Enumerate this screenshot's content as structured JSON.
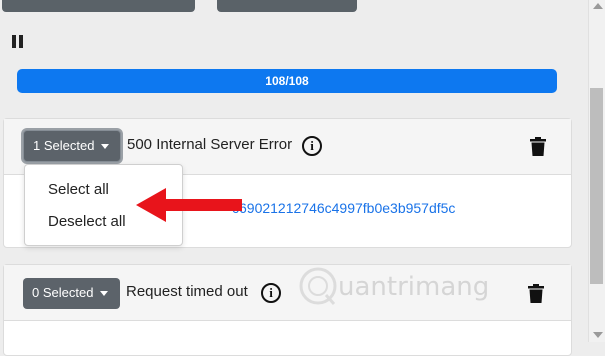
{
  "progress": {
    "text": "108/108",
    "value": 1.0
  },
  "groups": [
    {
      "select_label": "1 Selected",
      "error_text": "500 Internal Server Error",
      "link_text": "c69021212746c4997fb0e3b957df5c"
    },
    {
      "select_label": "0 Selected",
      "error_text": "Request timed out"
    }
  ],
  "dropdown_menu": {
    "items": [
      "Select all",
      "Deselect all"
    ]
  },
  "watermark": {
    "text": "Quantrimang"
  },
  "colors": {
    "progress": "#0d78f0",
    "button": "#5c636a",
    "link": "#1a73e8",
    "arrow": "#e8141b"
  },
  "icons": {
    "pause": "pause-icon",
    "info": "info-icon",
    "trash": "trash-icon",
    "caret": "caret-down-icon"
  }
}
